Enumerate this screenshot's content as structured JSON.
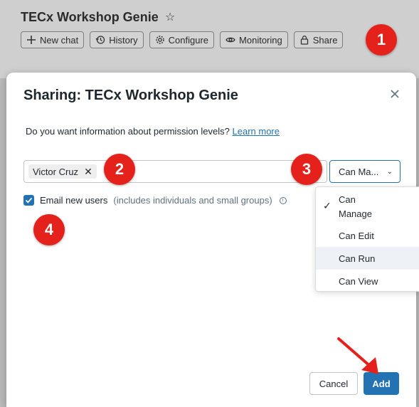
{
  "app": {
    "title": "TECx Workshop Genie",
    "toolbar": {
      "new_chat": "New chat",
      "history": "History",
      "configure": "Configure",
      "monitoring": "Monitoring",
      "share": "Share"
    }
  },
  "dialog": {
    "title": "Sharing: TECx Workshop Genie",
    "info_text": "Do you want information about permission levels?",
    "learn_more": "Learn more",
    "chip_user": "Victor Cruz",
    "permission_selected": "Can Ma...",
    "email_label": "Email new users",
    "email_note": "(includes individuals and small groups)",
    "email_checked": true,
    "permission_options": [
      "Can",
      "Manage",
      "Can Edit",
      "Can Run",
      "Can View"
    ],
    "cancel": "Cancel",
    "add": "Add"
  },
  "annotations": [
    "1",
    "2",
    "3",
    "4"
  ],
  "colors": {
    "accent": "#2272b4",
    "badge": "#e5211b",
    "arrow": "#e5211b",
    "dropdown_hover": "#eef2f6"
  }
}
